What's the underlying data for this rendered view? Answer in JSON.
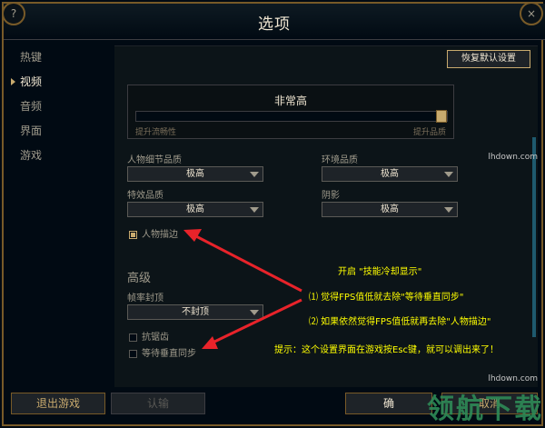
{
  "window": {
    "title": "选项"
  },
  "sidebar": {
    "items": [
      {
        "label": "热键",
        "active": false
      },
      {
        "label": "视频",
        "active": true
      },
      {
        "label": "音频",
        "active": false
      },
      {
        "label": "界面",
        "active": false
      },
      {
        "label": "游戏",
        "active": false
      }
    ]
  },
  "toolbar": {
    "reset_label": "恢复默认设置"
  },
  "quality": {
    "title": "非常高",
    "low_label": "提升流畅性",
    "high_label": "提升品质",
    "level": 1.0
  },
  "fields": {
    "character_quality": {
      "label": "人物细节品质",
      "value": "极高"
    },
    "environment_quality": {
      "label": "环境品质",
      "value": "极高"
    },
    "effects_quality": {
      "label": "特效品质",
      "value": "极高"
    },
    "shadows": {
      "label": "阴影",
      "value": "极高"
    },
    "character_outline": {
      "label": "人物描边",
      "checked": true
    }
  },
  "advanced": {
    "title": "高级",
    "frame_rate": {
      "label": "帧率封顶",
      "value": "不封顶"
    },
    "antialias": {
      "label": "抗锯齿",
      "checked": false
    },
    "vsync": {
      "label": "等待垂直同步",
      "checked": false
    }
  },
  "annotations": {
    "line1": "开启 \"技能冷却显示\"",
    "line2": "⑴ 觉得FPS值低就去除\"等待垂直同步\"",
    "line3": "⑵ 如果依然觉得FPS值低就再去除\"人物描边\"",
    "line4": "提示：这个设置界面在游戏按Esc键，就可以调出来了！"
  },
  "bottom": {
    "exit_label": "退出游戏",
    "surrender_label": "认输",
    "ok_label": "确",
    "cancel_label": "取消"
  },
  "watermark": {
    "text": "领航下载",
    "url_top": "lhdown.com",
    "url_bottom": "lhdown.com"
  },
  "colors": {
    "gold": "#c8aa6e",
    "annotation": "#ffff00",
    "arrow": "#e8232a",
    "watermark": "#2e8b57"
  }
}
